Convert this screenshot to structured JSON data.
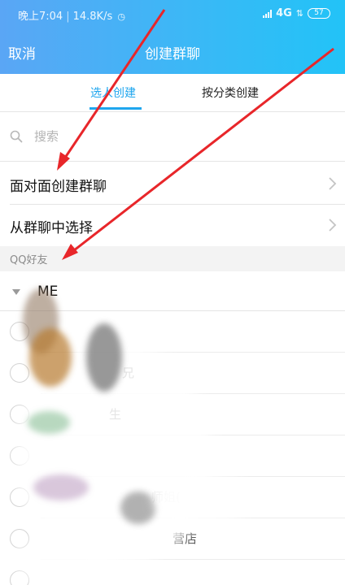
{
  "status_bar": {
    "time": "晚上7:04",
    "speed": "14.8K/s",
    "network": "4G",
    "battery": "57"
  },
  "nav": {
    "cancel": "取消",
    "title": "创建群聊"
  },
  "tabs": [
    {
      "label": "选人创建",
      "active": true
    },
    {
      "label": "按分类创建",
      "active": false
    }
  ],
  "search": {
    "placeholder": "搜索"
  },
  "options": [
    {
      "label": "面对面创建群聊"
    },
    {
      "label": "从群聊中选择"
    }
  ],
  "section_header": "QQ好友",
  "group": {
    "name": "ME"
  },
  "friends": [
    {
      "name": ""
    },
    {
      "name": "兄"
    },
    {
      "name": "生"
    },
    {
      "name": ""
    },
    {
      "name": "师姐("
    },
    {
      "name": "营店"
    },
    {
      "name": ""
    }
  ],
  "colors": {
    "accent": "#1fa6ee",
    "annotation_arrow": "#e8262a"
  },
  "icons": {
    "search": "search-icon",
    "chevron": "chevron-right-icon",
    "group_toggle": "triangle-down-icon",
    "radio": "radio-unchecked-icon"
  }
}
